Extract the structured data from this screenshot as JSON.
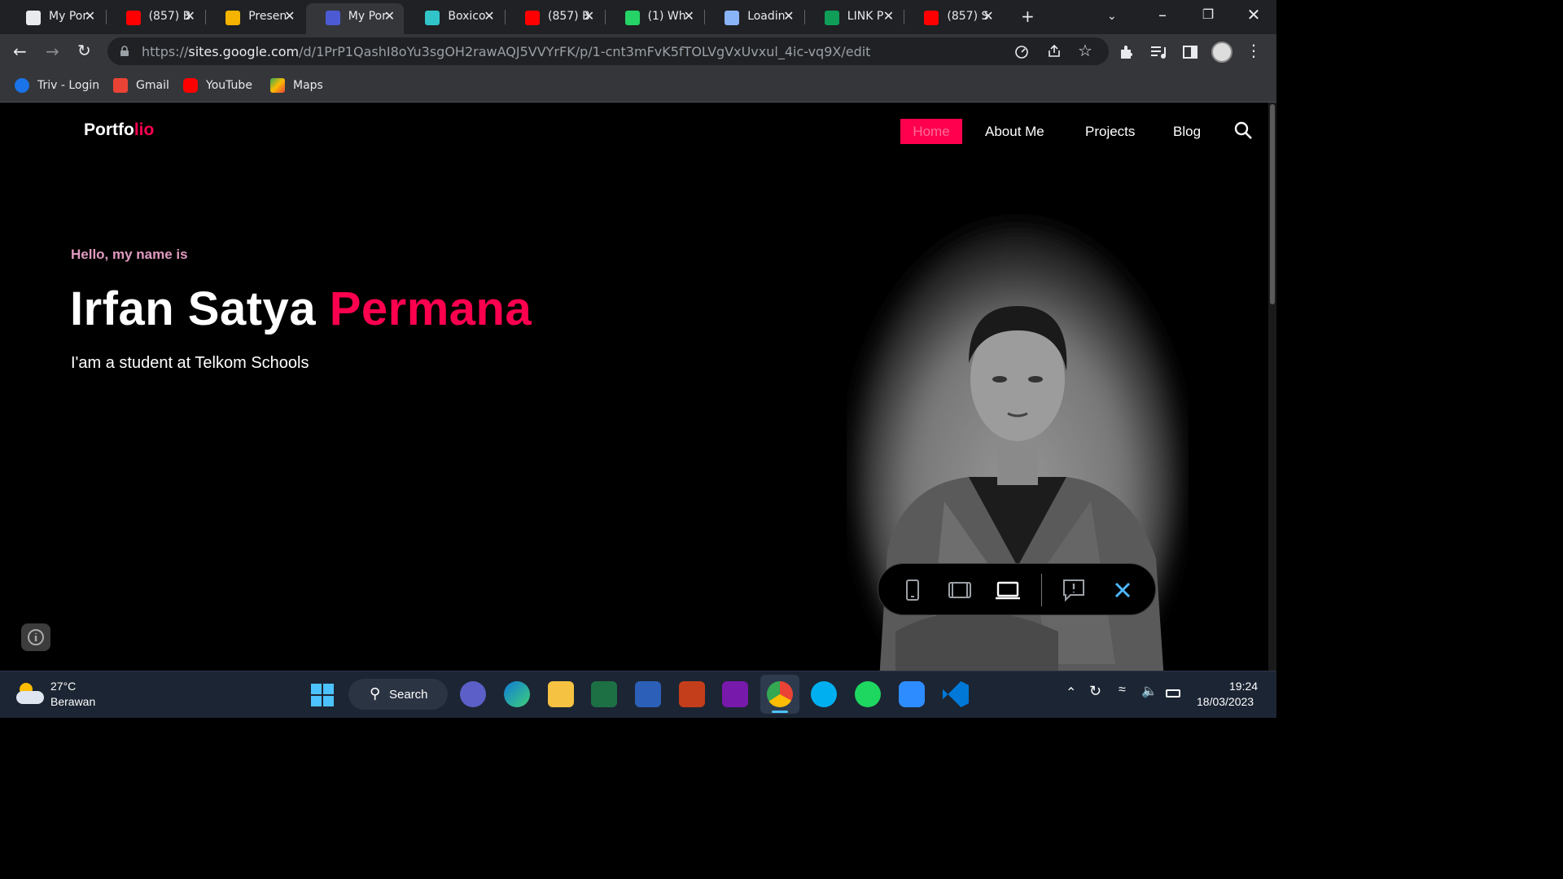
{
  "browser": {
    "tabs": [
      {
        "label": "My Por",
        "color": "#e8eaed",
        "active": false
      },
      {
        "label": "(857) B",
        "color": "#ff0000",
        "active": false
      },
      {
        "label": "Presen",
        "color": "#f4b400",
        "active": false
      },
      {
        "label": "My Por",
        "color": "#4c5bd4",
        "active": true
      },
      {
        "label": "Boxico",
        "color": "#31c4c9",
        "active": false
      },
      {
        "label": "(857) B",
        "color": "#ff0000",
        "active": false
      },
      {
        "label": "(1) Wh",
        "color": "#25d366",
        "active": false
      },
      {
        "label": "Loadin",
        "color": "#8ab4f8",
        "active": false
      },
      {
        "label": "LINK P",
        "color": "#0f9d58",
        "active": false
      },
      {
        "label": "(857) S",
        "color": "#ff0000",
        "active": false
      }
    ],
    "url": {
      "prefix": "https://",
      "host": "sites.google.com",
      "path": "/d/1PrP1QashI8oYu3sgOH2rawAQJ5VVYrFK/p/1-cnt3mFvK5fTOLVgVxUvxul_4ic-vq9X/edit"
    },
    "bookmarks": [
      {
        "label": "Triv - Login",
        "color": "#1a73e8"
      },
      {
        "label": "Gmail",
        "color": "#ea4335"
      },
      {
        "label": "YouTube",
        "color": "#ff0000"
      },
      {
        "label": "Maps",
        "color": "#34a853"
      }
    ]
  },
  "site": {
    "logo_main": "Portfo",
    "logo_accent": "lio",
    "nav": [
      "Home",
      "About Me",
      "Projects",
      "Blog"
    ],
    "greeting": "Hello, my name is",
    "name_first": "Irfan Satya",
    "name_last": "Permana",
    "subtitle": "I'am a student at Telkom Schools",
    "accent_color": "#ff004f"
  },
  "taskbar": {
    "weather_temp": "27°C",
    "weather_desc": "Berawan",
    "search_label": "Search",
    "time": "19:24",
    "date": "18/03/2023"
  }
}
